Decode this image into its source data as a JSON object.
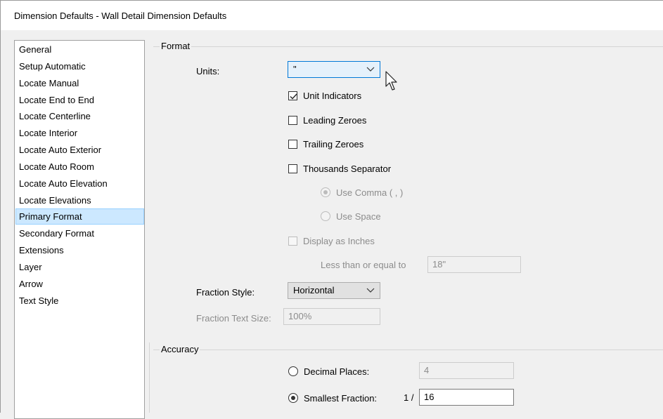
{
  "window": {
    "title": "Dimension Defaults - Wall Detail Dimension Defaults"
  },
  "sidebar": {
    "items": [
      {
        "label": "General"
      },
      {
        "label": "Setup Automatic"
      },
      {
        "label": "Locate Manual"
      },
      {
        "label": "Locate End to End"
      },
      {
        "label": "Locate Centerline"
      },
      {
        "label": "Locate Interior"
      },
      {
        "label": "Locate Auto Exterior"
      },
      {
        "label": "Locate Auto Room"
      },
      {
        "label": "Locate Auto Elevation"
      },
      {
        "label": "Locate Elevations"
      },
      {
        "label": "Primary Format",
        "selected": true
      },
      {
        "label": "Secondary Format"
      },
      {
        "label": "Extensions"
      },
      {
        "label": "Layer"
      },
      {
        "label": "Arrow"
      },
      {
        "label": "Text Style"
      }
    ]
  },
  "format": {
    "group_label": "Format",
    "units_label": "Units:",
    "units_value": "\"",
    "unit_indicators": {
      "label": "Unit Indicators",
      "checked": true
    },
    "leading_zeroes": {
      "label": "Leading Zeroes",
      "checked": false
    },
    "trailing_zeroes": {
      "label": "Trailing Zeroes",
      "checked": false
    },
    "thousands_separator": {
      "label": "Thousands Separator",
      "checked": false
    },
    "use_comma": {
      "label": "Use Comma ( , )",
      "selected": true,
      "enabled": false
    },
    "use_space": {
      "label": "Use Space",
      "selected": false,
      "enabled": false
    },
    "display_as_inches": {
      "label": "Display as Inches",
      "checked": false,
      "enabled": false
    },
    "less_than_label": "Less than or equal to",
    "less_than_value": "18\"",
    "fraction_style_label": "Fraction Style:",
    "fraction_style_value": "Horizontal",
    "fraction_text_size_label": "Fraction Text Size:",
    "fraction_text_size_value": "100%"
  },
  "accuracy": {
    "group_label": "Accuracy",
    "decimal_places": {
      "label": "Decimal Places:",
      "selected": false,
      "value": "4"
    },
    "smallest_fraction": {
      "label": "Smallest Fraction:",
      "selected": true,
      "prefix": "1 /",
      "value": "16"
    }
  },
  "icons": {
    "chevron": "chevron-down-icon",
    "check": "check-icon",
    "cursor": "mouse-pointer-icon"
  },
  "colors": {
    "selection_bg": "#cce8ff",
    "focus_border": "#0078d7",
    "disabled_text": "#8c8c8c"
  }
}
